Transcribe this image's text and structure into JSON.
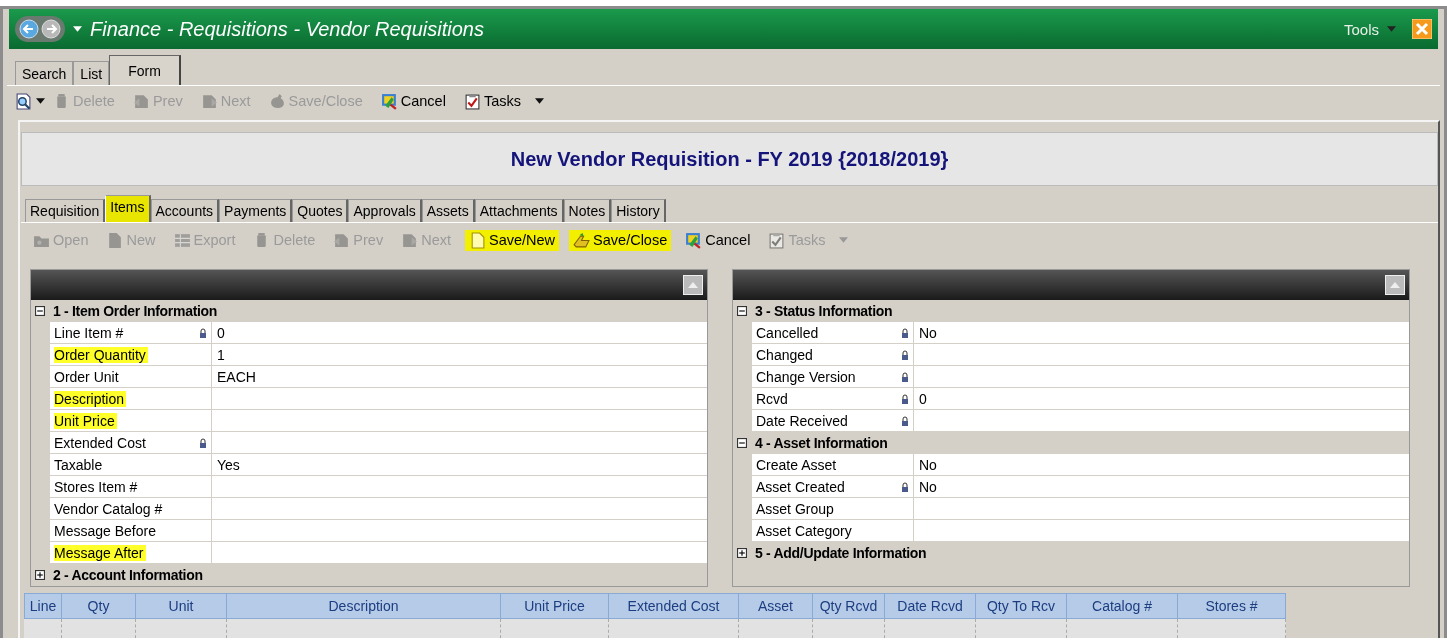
{
  "window": {
    "title": "Finance - Requisitions - Vendor Requisitions",
    "menu": "Tools"
  },
  "view_tabs": [
    {
      "label": "Search",
      "selected": false
    },
    {
      "label": "List",
      "selected": false
    },
    {
      "label": "Form",
      "selected": true
    }
  ],
  "toolbar": [
    {
      "label": "Delete",
      "disabled": true,
      "highlighted": false
    },
    {
      "label": "Prev",
      "disabled": true,
      "highlighted": false
    },
    {
      "label": "Next",
      "disabled": true,
      "highlighted": false
    },
    {
      "label": "Save/Close",
      "disabled": true,
      "highlighted": false
    },
    {
      "label": "Cancel",
      "disabled": false,
      "highlighted": false
    },
    {
      "label": "Tasks",
      "disabled": false,
      "highlighted": false
    }
  ],
  "form_title": "New Vendor Requisition - FY 2019 {2018/2019}",
  "form_tabs": [
    {
      "label": "Requisition",
      "selected": false,
      "highlighted": false
    },
    {
      "label": "Items",
      "selected": true,
      "highlighted": true
    },
    {
      "label": "Accounts",
      "selected": false,
      "highlighted": false
    },
    {
      "label": "Payments",
      "selected": false,
      "highlighted": false
    },
    {
      "label": "Quotes",
      "selected": false,
      "highlighted": false
    },
    {
      "label": "Approvals",
      "selected": false,
      "highlighted": false
    },
    {
      "label": "Assets",
      "selected": false,
      "highlighted": false
    },
    {
      "label": "Attachments",
      "selected": false,
      "highlighted": false
    },
    {
      "label": "Notes",
      "selected": false,
      "highlighted": false
    },
    {
      "label": "History",
      "selected": false,
      "highlighted": false
    }
  ],
  "form_toolbar": [
    {
      "label": "Open",
      "disabled": true,
      "highlighted": false
    },
    {
      "label": "New",
      "disabled": true,
      "highlighted": false
    },
    {
      "label": "Export",
      "disabled": true,
      "highlighted": false
    },
    {
      "label": "Delete",
      "disabled": true,
      "highlighted": false
    },
    {
      "label": "Prev",
      "disabled": true,
      "highlighted": false
    },
    {
      "label": "Next",
      "disabled": true,
      "highlighted": false
    },
    {
      "label": "Save/New",
      "disabled": false,
      "highlighted": true
    },
    {
      "label": "Save/Close",
      "disabled": false,
      "highlighted": true
    },
    {
      "label": "Cancel",
      "disabled": false,
      "highlighted": false
    },
    {
      "label": "Tasks",
      "disabled": true,
      "highlighted": false
    }
  ],
  "item_panel": {
    "sections": [
      {
        "title": "1 - Item Order Information",
        "expanded": true,
        "fields": [
          {
            "label": "Line Item #",
            "locked": true,
            "highlighted": false,
            "value": "0"
          },
          {
            "label": "Order Quantity",
            "locked": false,
            "highlighted": true,
            "value": "1"
          },
          {
            "label": "Order Unit",
            "locked": false,
            "highlighted": false,
            "value": "EACH"
          },
          {
            "label": "Description",
            "locked": false,
            "highlighted": true
          },
          {
            "label": "Unit Price",
            "locked": false,
            "highlighted": true
          },
          {
            "label": "Extended Cost",
            "locked": true,
            "highlighted": false
          },
          {
            "label": "Taxable",
            "locked": false,
            "highlighted": false,
            "value": "Yes"
          },
          {
            "label": "Stores Item #",
            "locked": false,
            "highlighted": false
          },
          {
            "label": "Vendor Catalog #",
            "locked": false,
            "highlighted": false
          },
          {
            "label": "Message Before",
            "locked": false,
            "highlighted": false
          },
          {
            "label": "Message After",
            "locked": false,
            "highlighted": true
          }
        ]
      },
      {
        "title": "2 - Account Information",
        "expanded": false
      }
    ]
  },
  "status_panel": {
    "sections": [
      {
        "title": "3 - Status Information",
        "expanded": true,
        "fields": [
          {
            "label": "Cancelled",
            "locked": true,
            "highlighted": false,
            "value": "No"
          },
          {
            "label": "Changed",
            "locked": true,
            "highlighted": false
          },
          {
            "label": "Change Version",
            "locked": true,
            "highlighted": false
          },
          {
            "label": "Rcvd",
            "locked": true,
            "highlighted": false,
            "value": "0"
          },
          {
            "label": "Date Received",
            "locked": true,
            "highlighted": false
          }
        ]
      },
      {
        "title": "4 - Asset Information",
        "expanded": true,
        "fields": [
          {
            "label": "Create Asset",
            "locked": false,
            "highlighted": false,
            "value": "No"
          },
          {
            "label": "Asset Created",
            "locked": true,
            "highlighted": false,
            "value": "No"
          },
          {
            "label": "Asset Group",
            "locked": false,
            "highlighted": false
          },
          {
            "label": "Asset Category",
            "locked": false,
            "highlighted": false
          }
        ]
      },
      {
        "title": "5 - Add/Update Information",
        "expanded": false
      }
    ]
  },
  "items_grid": {
    "columns": [
      "Line",
      "Qty",
      "Unit",
      "Description",
      "Unit Price",
      "Extended Cost",
      "Asset",
      "Qty Rcvd",
      "Date Rcvd",
      "Qty To Rcv",
      "Catalog #",
      "Stores #"
    ]
  }
}
